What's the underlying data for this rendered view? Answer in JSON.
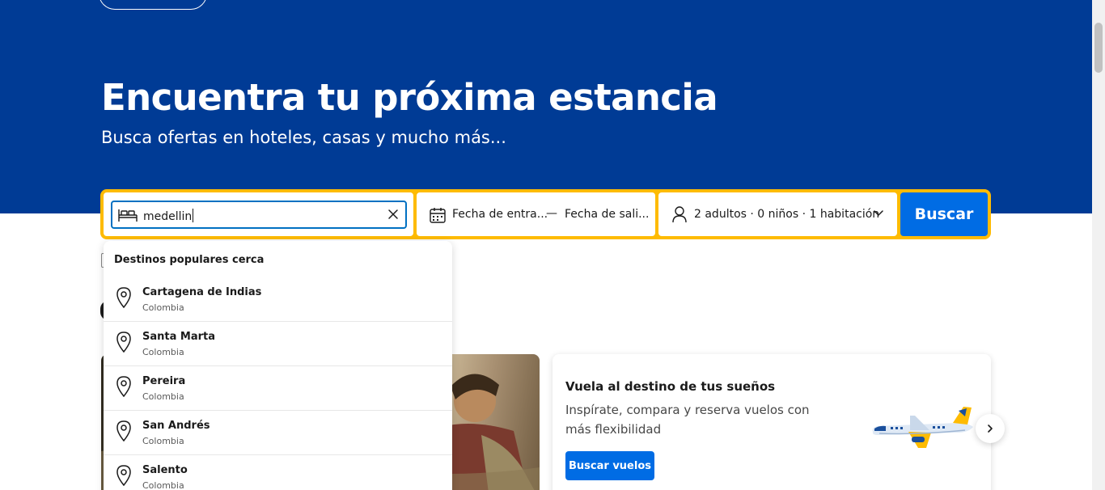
{
  "hero": {
    "title": "Encuentra tu próxima estancia",
    "subtitle": "Busca ofertas en hoteles, casas y mucho más..."
  },
  "search": {
    "destination_value": "medellin",
    "checkin_label": "Fecha de entra...",
    "date_separator": "—",
    "checkout_label": "Fecha de sali...",
    "guests_label": "2 adultos · 0 niños · 1 habitación",
    "submit_label": "Buscar"
  },
  "dropdown": {
    "title": "Destinos populares cerca",
    "items": [
      {
        "name": "Cartagena de Indias",
        "country": "Colombia",
        "icon": "map-pin-icon"
      },
      {
        "name": "Santa Marta",
        "country": "Colombia",
        "icon": "map-pin-icon"
      },
      {
        "name": "Pereira",
        "country": "Colombia",
        "icon": "map-pin-icon"
      },
      {
        "name": "San Andrés",
        "country": "Colombia",
        "icon": "map-pin-icon"
      },
      {
        "name": "Salento",
        "country": "Colombia",
        "icon": "map-pin-icon"
      }
    ]
  },
  "promo": {
    "title": "Vuela al destino de tus sueños",
    "description": "Inspírate, compara y reserva vuelos con más flexibilidad",
    "button_label": "Buscar vuelos"
  },
  "colors": {
    "brand_blue": "#003b95",
    "action_blue": "#006ce4",
    "search_border_yellow": "#febb02"
  }
}
